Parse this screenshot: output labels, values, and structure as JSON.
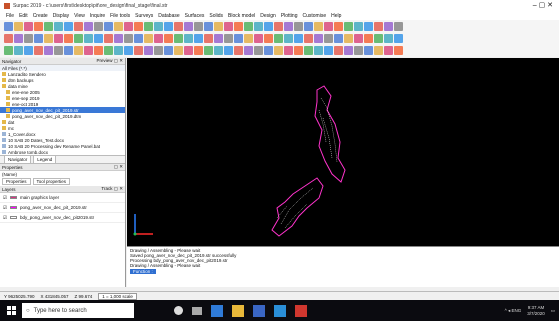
{
  "titlebar": {
    "title": "Surpac 2019 - c:\\users\\first\\desktop\\pit\\ore_design\\final_stage\\final.str",
    "window_controls": "– ▢ ✕"
  },
  "menu": [
    "File",
    "Edit",
    "Create",
    "Display",
    "View",
    "Inquire",
    "File tools",
    "Surveys",
    "Database",
    "Surfaces",
    "Solids",
    "Block model",
    "Design",
    "Plotting",
    "Customise",
    "Help"
  ],
  "navigator": {
    "title": "Navigator",
    "controls": "Preview ▢ ✕",
    "path": "All Files (*.*)",
    "items": [
      {
        "label": "Lanzadito Sendero",
        "selected": false
      },
      {
        "label": "dtm backups",
        "selected": false
      },
      {
        "label": "data mine",
        "selected": false
      },
      {
        "label": "ene-ene 2005",
        "selected": false
      },
      {
        "label": "ene-sep 2019",
        "selected": false
      },
      {
        "label": "ene-oct 2019",
        "selected": false
      },
      {
        "label": "pong_aver_nov_dec_pit_2019.str",
        "selected": true
      },
      {
        "label": "pong_aver_nov_dec_pit_2019.dtm",
        "selected": false
      },
      {
        "label": "dat",
        "selected": false
      },
      {
        "label": "mc",
        "selected": false
      },
      {
        "label": "1_Cover.docx",
        "selected": false
      },
      {
        "label": "10 SAB 20 Dates_Test.docx",
        "selected": false
      },
      {
        "label": "10 SAB 20 Processing dev Rename Panel.bat",
        "selected": false
      },
      {
        "label": "Ambrose tomb.docx",
        "selected": false
      }
    ],
    "tabs": [
      "Navigator",
      "Legend"
    ]
  },
  "properties": {
    "title": "Properties",
    "controls": "▢ ✕",
    "name_label": "(Name)",
    "tabs": [
      "Properties",
      "Tool properties"
    ]
  },
  "layers": {
    "title": "Layers",
    "controls": "Track ▢ ✕",
    "rows": [
      {
        "label": "main graphics layer",
        "color": "#d63384"
      },
      {
        "label": "pong_aver_nov_dec_pit_2019.str",
        "color": "#ff00ff"
      },
      {
        "label": "bdy_pong_aver_nov_dec_pit2019.str",
        "color": "#ffffff"
      }
    ]
  },
  "command": {
    "lines": [
      "Drawing / Assembling - Please wait",
      "Saved pong_aver_nov_dec_pit_2019.str successfully",
      "Processing bdy_pong_aver_nov_dec_pit2019.str",
      "Drawing / Assembling - Please wait"
    ],
    "prompt": "Function :"
  },
  "statusbar": {
    "y": "Y 9625025.790",
    "x": "X 431845.057",
    "z": "Z 99.674",
    "scale": "1 = 1,000 scale"
  },
  "taskbar": {
    "search_placeholder": "Type here to search",
    "time": "9:37 AM",
    "date": "3/7/2020",
    "tray": "^ ◂ ENG"
  },
  "colors": {
    "canvas": "#000000",
    "pit_outline": "#ff33cc",
    "pit_fill_lines": "#f0f0f0",
    "axis_x": "#ff2a2a",
    "axis_y": "#2a7fff",
    "axis_z": "#22c055",
    "selection": "#3a78d6"
  }
}
